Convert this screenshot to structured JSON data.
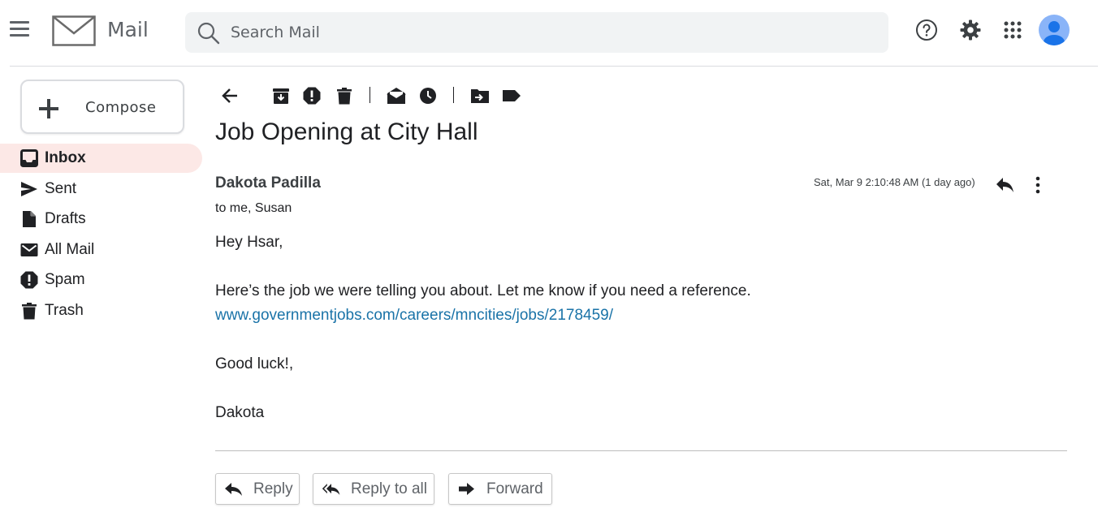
{
  "app": {
    "name": "Mail"
  },
  "search": {
    "placeholder": "Search Mail"
  },
  "compose": {
    "label": "Compose"
  },
  "sidebar": {
    "items": [
      {
        "label": "Inbox",
        "icon": "inbox-icon",
        "active": true
      },
      {
        "label": "Sent",
        "icon": "send-icon",
        "active": false
      },
      {
        "label": "Drafts",
        "icon": "draft-icon",
        "active": false
      },
      {
        "label": "All Mail",
        "icon": "mail-icon",
        "active": false
      },
      {
        "label": "Spam",
        "icon": "spam-icon",
        "active": false
      },
      {
        "label": "Trash",
        "icon": "trash-icon",
        "active": false
      }
    ]
  },
  "toolbar": {
    "icons": [
      "back-arrow-icon",
      "archive-icon",
      "report-spam-icon",
      "delete-icon",
      "mark-read-icon",
      "snooze-icon",
      "move-to-icon",
      "label-icon"
    ]
  },
  "email": {
    "subject": "Job Opening at City Hall",
    "sender": "Dakota Padilla",
    "recipients": "to me, Susan",
    "date": "Sat, Mar 9 2:10:48 AM (1 day ago)",
    "greeting": "Hey Hsar,",
    "paragraph": "Here’s the job we were telling you about. Let me know if you need a reference.",
    "link": "www.governmentjobs.com/careers/mncities/jobs/2178459/",
    "closing": "Good luck!,",
    "signature": "Dakota"
  },
  "actions": {
    "reply": "Reply",
    "reply_all": "Reply to all",
    "forward": "Forward"
  },
  "colors": {
    "active_nav_bg": "#fce8e6",
    "link": "#1a73a8",
    "search_bg": "#f1f3f4",
    "avatar": "#8ab4f8"
  }
}
